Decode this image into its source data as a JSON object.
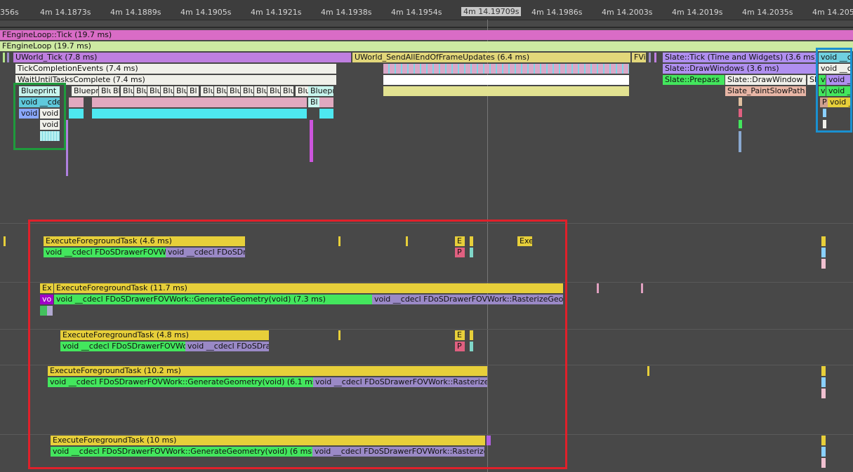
{
  "ruler": {
    "labels": [
      "356s",
      "4m 14.1873s",
      "4m 14.1889s",
      "4m 14.1905s",
      "4m 14.1921s",
      "4m 14.1938s",
      "4m 14.1954s",
      "4m 14.1986s",
      "4m 14.2003s",
      "4m 14.2019s",
      "4m 14.2035s",
      "4m 14.2051"
    ],
    "cursor": "4m 14.19709s"
  },
  "main": {
    "engine_tick": "FEngineLoop::Tick (19.7 ms)",
    "engine_loop": "FEngineLoop (19.7 ms)",
    "uworld_tick": "UWorld_Tick (7.8 ms)",
    "send_updates": "UWorld_SendAllEndOfFrameUpdates (6.4 ms)",
    "fvi": "FVi",
    "slate_tick": "Slate::Tick (Time and Widgets) (3.6 ms)",
    "void_c1": "void __c",
    "tick_completion": "TickCompletionEvents (7.4 ms)",
    "slate_drawwindows": "Slate::DrawWindows (3.6 ms)",
    "void_c2": "void __c",
    "wait_tasks": "WaitUntilTasksComplete (7.4 ms)",
    "slate_prepass": "Slate::Prepass",
    "slate_drawwindow": "Slate::DrawWindow (1.",
    "sl": "Sl",
    "v1": "v",
    "void_short1": "void _",
    "blueprint": "Blueprint",
    "bp_row": [
      "Bluepr",
      "Blu",
      "Bl",
      "Blu",
      "Blu",
      "Blu",
      "Blu",
      "Blu",
      "Bl",
      "Blu",
      "Blu",
      "Blu",
      "Blu",
      "Blu",
      "Blu",
      "Blu",
      "Blu",
      "Bluepr"
    ],
    "slate_paintslow": "Slate_PaintSlowPath (",
    "v2": "v",
    "void_short2": "void _",
    "void_cde": "void __cde",
    "bl": "Bl",
    "p_short": "P",
    "void_short3": "void _",
    "void_a": "void",
    "void_b": "void",
    "void_c": "void"
  },
  "tracks": [
    {
      "task": "ExecuteForegroundTask (4.6 ms)",
      "gen": "void __cdecl FDoSDrawerFOVWor",
      "rast": "void __cdecl FDoSDra",
      "extra": [
        "E",
        "P",
        "Exe"
      ]
    },
    {
      "ex": "Ex",
      "task": "ExecuteForegroundTask (11.7 ms)",
      "vo": "vo",
      "gen": "void __cdecl FDoSDrawerFOVWork::GenerateGeometry(void) (7.3 ms)",
      "rast": "void __cdecl FDoSDrawerFOVWork::RasterizeGeometr"
    },
    {
      "task": "ExecuteForegroundTask (4.8 ms)",
      "gen": "void __cdecl FDoSDrawerFOVWork::",
      "rast": "void __cdecl FDoSDraw",
      "extra": [
        "E",
        "P"
      ]
    },
    {
      "task": "ExecuteForegroundTask (10.2 ms)",
      "gen": "void __cdecl FDoSDrawerFOVWork::GenerateGeometry(void) (6.1 ms)",
      "rast": "void __cdecl FDoSDrawerFOVWork::RasterizeGeo"
    },
    {
      "task": "ExecuteForegroundTask (10 ms)",
      "gen": "void __cdecl FDoSDrawerFOVWork::GenerateGeometry(void) (6 ms)",
      "rast": "void __cdecl FDoSDrawerFOVWork::RasterizeGe"
    }
  ],
  "colors": {
    "highlight_red": "#e0202a",
    "highlight_green": "#1f9a3c",
    "highlight_blue": "#1a90d0",
    "task_yellow": "#e7cf3a",
    "gen_green": "#43e65d",
    "rast_purple": "#9a89c6"
  }
}
